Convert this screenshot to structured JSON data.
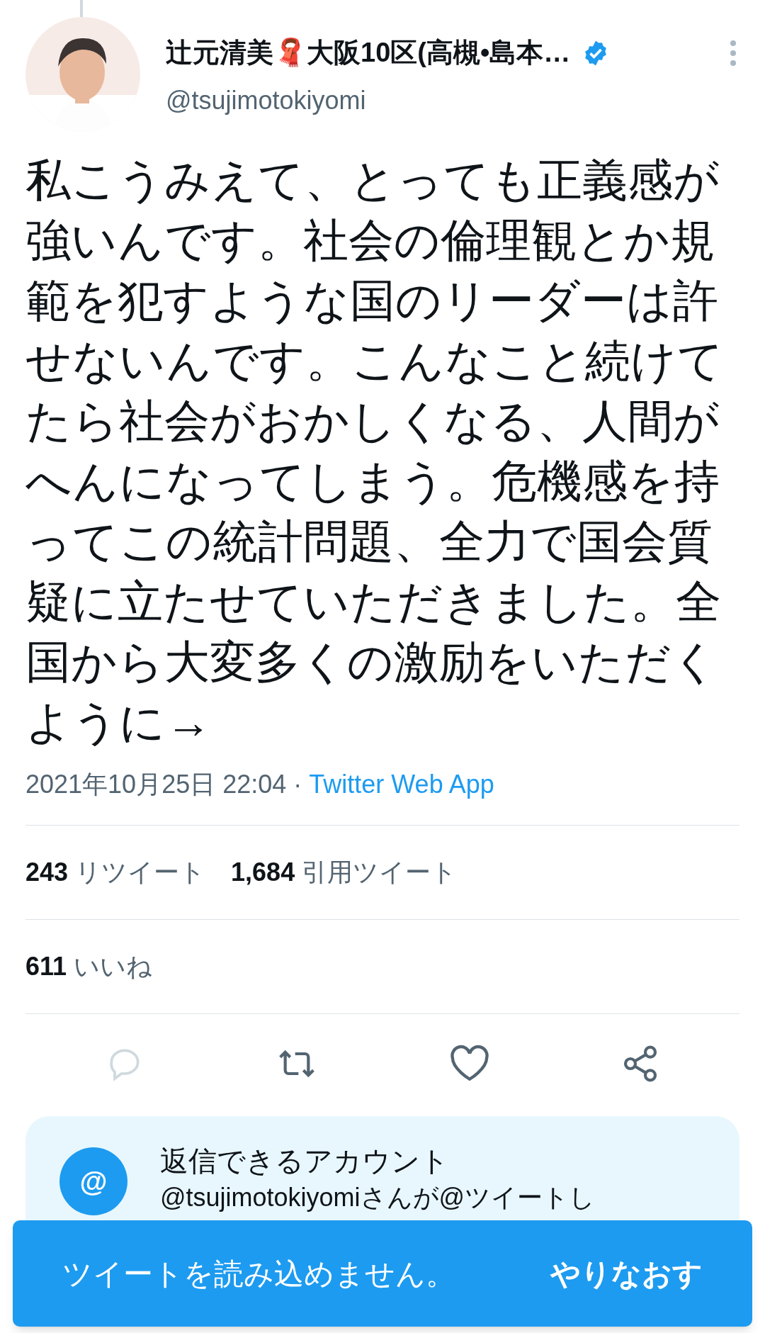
{
  "author": {
    "name": "辻元清美🧣大阪10区(高槻•島本…",
    "verified": true,
    "handle": "@tsujimotokiyomi"
  },
  "tweet": {
    "text": "私こうみえて、とっても正義感が強いんです。社会の倫理観とか規範を犯すような国のリーダーは許せないんです。こんなこと続けてたら社会がおかしくなる、人間がへんになってしまう。危機感を持ってこの統計問題、全力で国会質疑に立たせていただきました。全国から大変多くの激励をいただくように→",
    "timestamp": "2021年10月25日 22:04",
    "separator": "·",
    "source": "Twitter Web App"
  },
  "stats": [
    {
      "count": "243",
      "label": "リツイート"
    },
    {
      "count": "1,684",
      "label": "引用ツイート"
    }
  ],
  "likes": {
    "count": "611",
    "label": "いいね"
  },
  "reply_notice": {
    "icon": "@",
    "title": "返信できるアカウント",
    "text": "@tsujimotokiyomiさんが@ツイートし"
  },
  "toast": {
    "message": "ツイートを読み込めません。",
    "action": "やりなおす"
  }
}
